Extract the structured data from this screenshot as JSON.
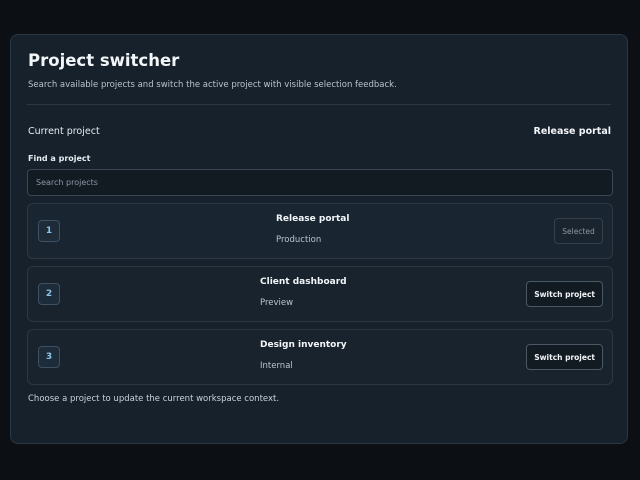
{
  "header": {
    "title": "Project switcher",
    "subtitle": "Search available projects and switch the active project with visible selection feedback."
  },
  "current": {
    "label": "Current project",
    "value": "Release portal"
  },
  "search": {
    "label": "Find a project",
    "placeholder": "Search projects",
    "value": ""
  },
  "projects": [
    {
      "index": "1",
      "name": "Release portal",
      "env": "Production",
      "action": "Selected",
      "selected": true
    },
    {
      "index": "2",
      "name": "Client dashboard",
      "env": "Preview",
      "action": "Switch project",
      "selected": false
    },
    {
      "index": "3",
      "name": "Design inventory",
      "env": "Internal",
      "action": "Switch project",
      "selected": false
    }
  ],
  "footer": {
    "note": "Choose a project to update the current workspace context."
  },
  "colors": {
    "background": "#0c0f14",
    "panel": "#17212b",
    "border": "#2b3744",
    "accent_index": "#8cc4e8",
    "muted_text": "#8a98a6"
  }
}
